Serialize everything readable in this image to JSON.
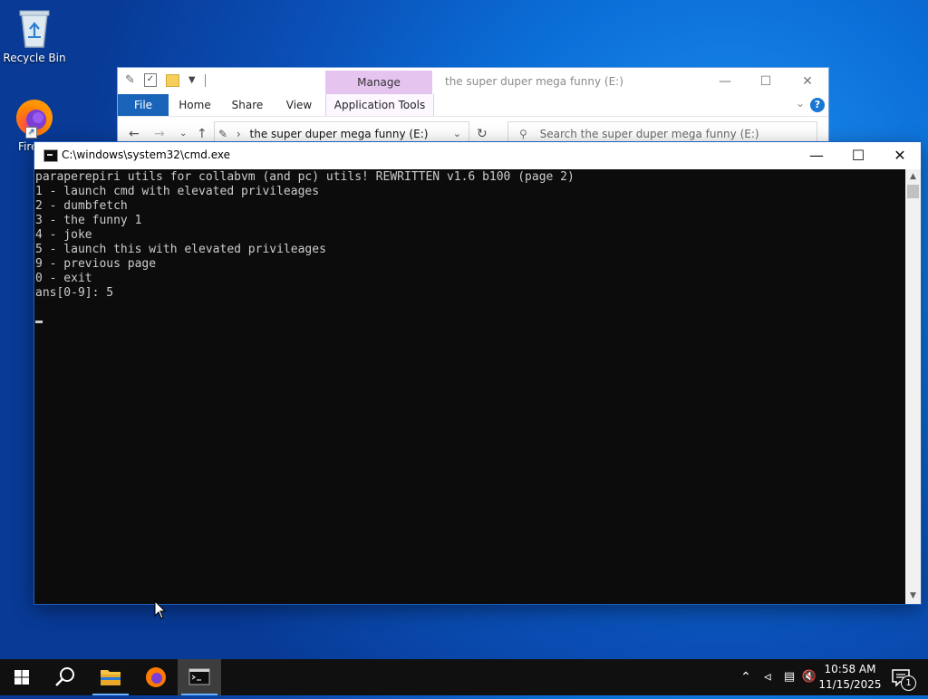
{
  "desktop": {
    "icons": [
      {
        "label": "Recycle Bin"
      },
      {
        "label": "Fire"
      }
    ]
  },
  "explorer": {
    "title": "the super duper mega funny (E:)",
    "manage_label": "Manage",
    "tabs": [
      "File",
      "Home",
      "Share",
      "View"
    ],
    "app_tools_label": "Application Tools",
    "address": "the super duper mega funny (E:)",
    "search_placeholder": "Search the super duper mega funny (E:)"
  },
  "cmd": {
    "title": "C:\\windows\\system32\\cmd.exe",
    "lines": [
      "paraperepiri utils for collabvm (and pc) utils! REWRITTEN v1.6 b100 (page 2)",
      "1 - launch cmd with elevated privileages",
      "2 - dumbfetch",
      "3 - the funny 1",
      "4 - joke",
      "5 - launch this with elevated privileages",
      "9 - previous page",
      "0 - exit",
      "ans[0-9]: 5"
    ]
  },
  "taskbar": {
    "time": "10:58 AM",
    "date": "11/15/2025",
    "notification_count": "1"
  },
  "colors": {
    "accent": "#1964b8",
    "manage_tab": "#e6c4f0",
    "console_bg": "#0c0c0c",
    "console_fg": "#cccccc"
  }
}
